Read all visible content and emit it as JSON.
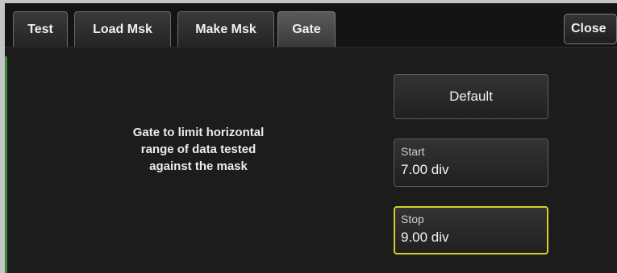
{
  "tabs": [
    {
      "label": "Test"
    },
    {
      "label": "Load Msk"
    },
    {
      "label": "Make Msk"
    },
    {
      "label": "Gate",
      "active": true
    }
  ],
  "close_label": "Close",
  "description": [
    "Gate to limit horizontal",
    "range of data tested",
    "against the mask"
  ],
  "default_label": "Default",
  "start": {
    "label": "Start",
    "value": "7.00 div"
  },
  "stop": {
    "label": "Stop",
    "value": "9.00 div"
  },
  "colors": {
    "background": "#1c1c1c",
    "focus_border": "#d8cc2a",
    "accent": "#3a8a3a"
  }
}
